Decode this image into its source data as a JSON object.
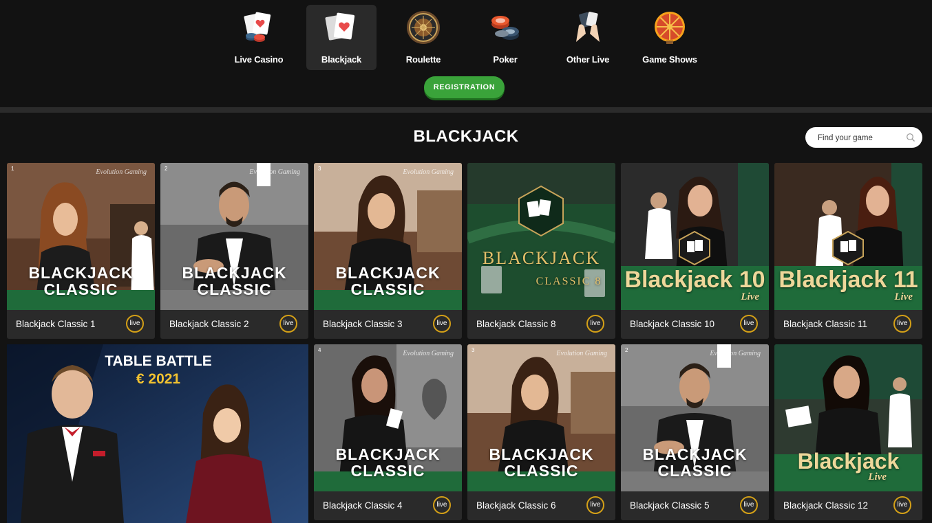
{
  "nav": {
    "items": [
      {
        "label": "Live Casino",
        "icon": "cards-chips-icon",
        "active": false
      },
      {
        "label": "Blackjack",
        "icon": "heart-card-icon",
        "active": true
      },
      {
        "label": "Roulette",
        "icon": "roulette-wheel-icon",
        "active": false
      },
      {
        "label": "Poker",
        "icon": "poker-chips-icon",
        "active": false
      },
      {
        "label": "Other Live",
        "icon": "hands-cards-icon",
        "active": false
      },
      {
        "label": "Game Shows",
        "icon": "prize-wheel-icon",
        "active": false
      }
    ],
    "registration_label": "REGISTRATION"
  },
  "header": {
    "title": "BLACKJACK",
    "search_placeholder": "Find your game"
  },
  "games": [
    {
      "title": "Blackjack Classic 1",
      "badge": "live",
      "corner": "1",
      "thumb_text": [
        "BLACKJACK",
        "CLASSIC"
      ],
      "provider": "Evolution Gaming"
    },
    {
      "title": "Blackjack Classic 2",
      "badge": "live",
      "corner": "2",
      "thumb_text": [
        "BLACKJACK",
        "CLASSIC"
      ],
      "provider": "Evolution Gaming"
    },
    {
      "title": "Blackjack Classic 3",
      "badge": "live",
      "corner": "3",
      "thumb_text": [
        "BLACKJACK",
        "CLASSIC"
      ],
      "provider": "Evolution Gaming"
    },
    {
      "title": "Blackjack Classic 8",
      "badge": "live",
      "corner": "",
      "thumb_text": [
        "BLACKJACK",
        "CLASSIC 8"
      ],
      "provider": ""
    },
    {
      "title": "Blackjack Classic 10",
      "badge": "live",
      "corner": "",
      "thumb_text": [
        "Blackjack 10",
        "Live"
      ],
      "provider": ""
    },
    {
      "title": "Blackjack Classic 11",
      "badge": "live",
      "corner": "",
      "thumb_text": [
        "Blackjack 11",
        "Live"
      ],
      "provider": ""
    },
    {
      "title": "Blackjack Classic 4",
      "badge": "live",
      "corner": "4",
      "thumb_text": [
        "BLACKJACK",
        "CLASSIC"
      ],
      "provider": "Evolution Gaming"
    },
    {
      "title": "Blackjack Classic 6",
      "badge": "live",
      "corner": "3",
      "thumb_text": [
        "BLACKJACK",
        "CLASSIC"
      ],
      "provider": "Evolution Gaming"
    },
    {
      "title": "Blackjack Classic 5",
      "badge": "live",
      "corner": "2",
      "thumb_text": [
        "BLACKJACK",
        "CLASSIC"
      ],
      "provider": "Evolution Gaming"
    },
    {
      "title": "Blackjack Classic 12",
      "badge": "live",
      "corner": "",
      "thumb_text": [
        "Blackjack",
        "Live"
      ],
      "provider": ""
    }
  ],
  "promo": {
    "line1": "TABLE BATTLE",
    "line2": "€ 2021"
  },
  "colors": {
    "accent_green": "#3aa33a",
    "badge_gold": "#d4a017",
    "card_bg": "#2a2a2a",
    "page_bg": "#131313"
  }
}
